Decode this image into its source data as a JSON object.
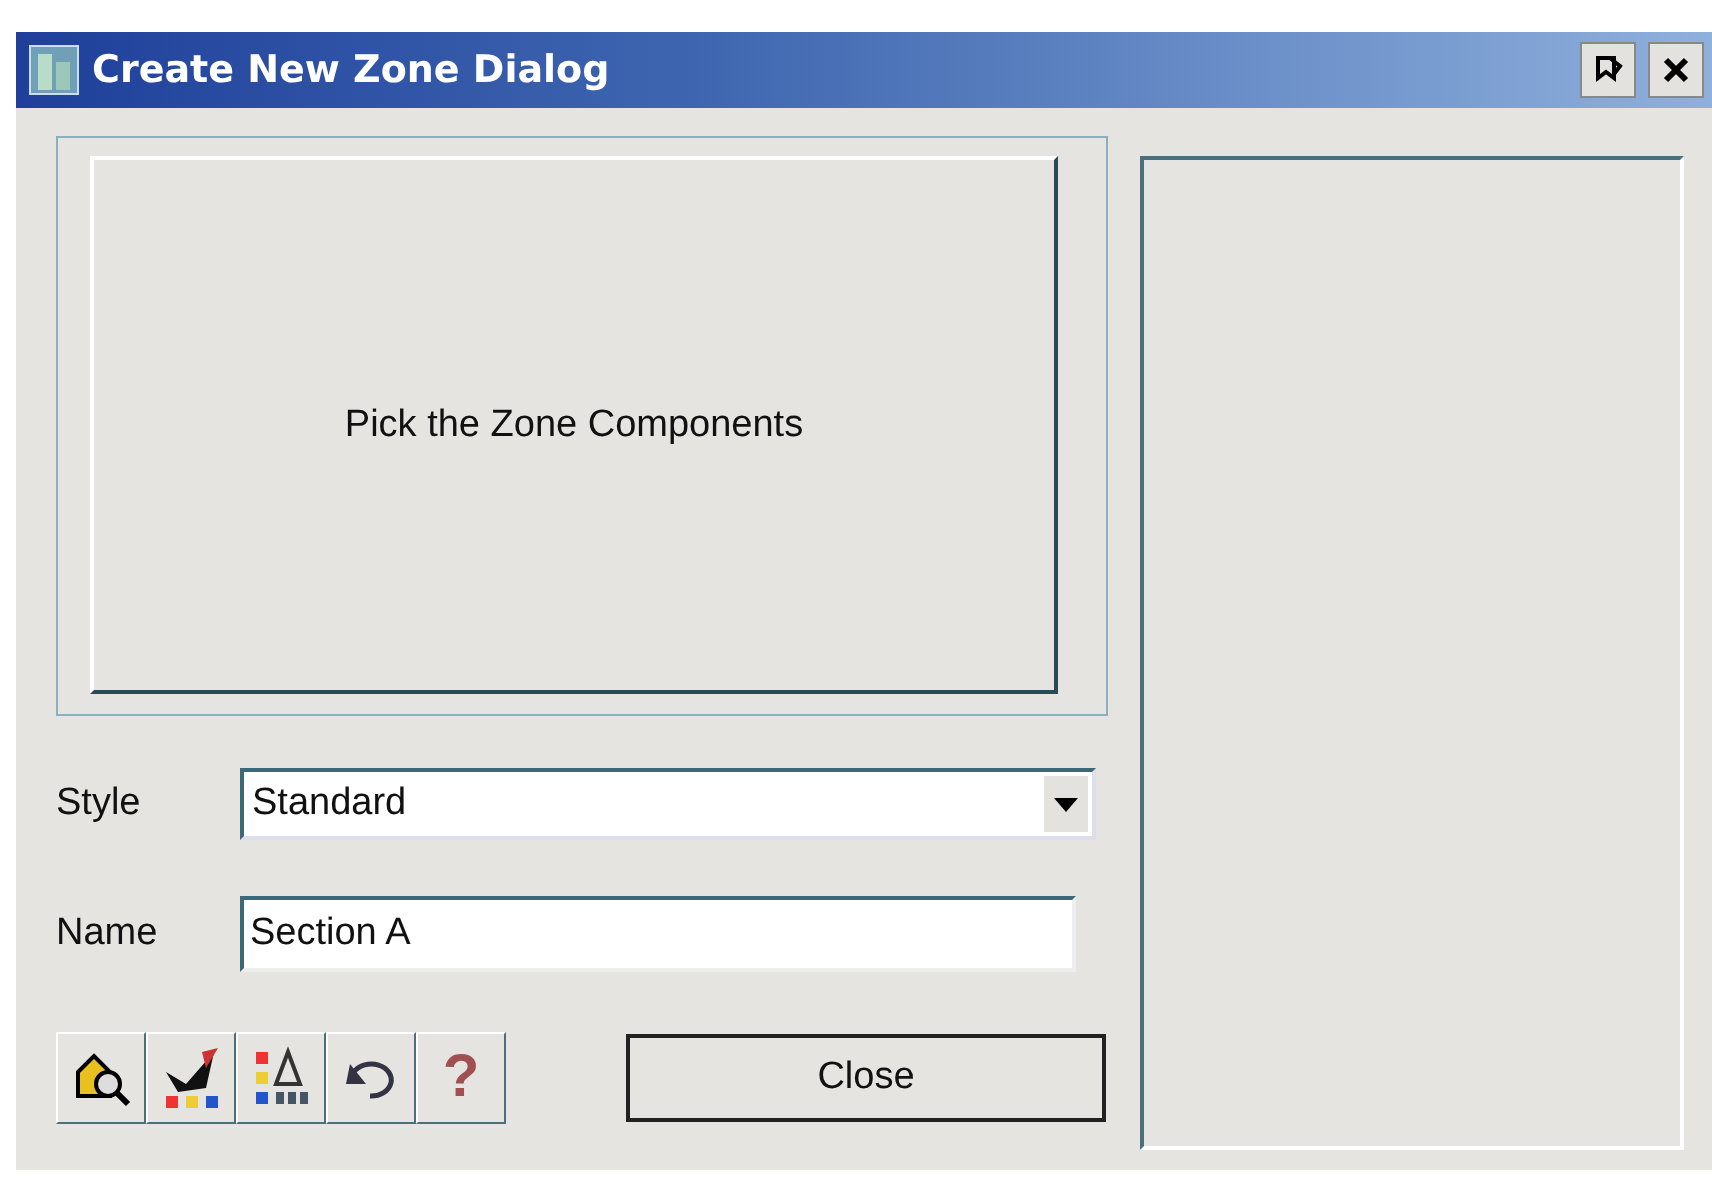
{
  "window": {
    "title": "Create New Zone Dialog"
  },
  "pick_button": {
    "label": "Pick the Zone Components"
  },
  "style": {
    "label": "Style",
    "value": "Standard"
  },
  "name": {
    "label": "Name",
    "value": "Section A"
  },
  "toolbar": [
    {
      "kind": "zoom"
    },
    {
      "kind": "paint"
    },
    {
      "kind": "chart"
    },
    {
      "kind": "undo"
    },
    {
      "kind": "help",
      "glyph": "?"
    }
  ],
  "close_button": {
    "label": "Close"
  }
}
